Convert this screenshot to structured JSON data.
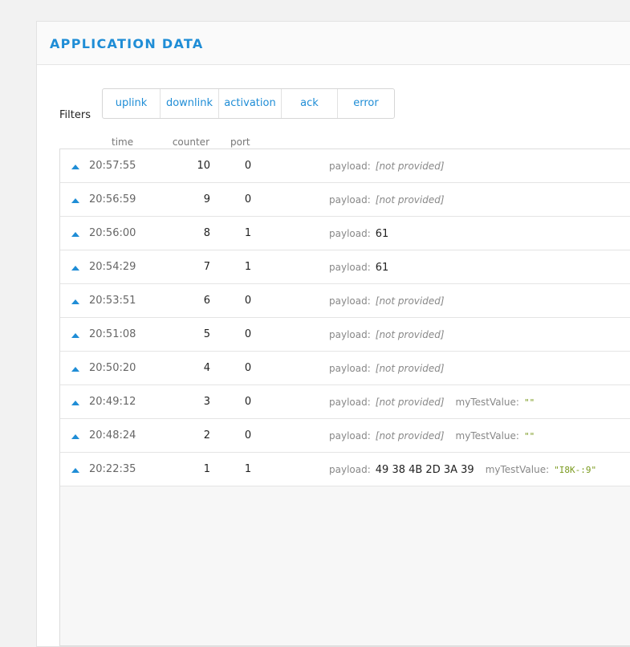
{
  "panel": {
    "title": "APPLICATION DATA"
  },
  "filters": {
    "label": "Filters",
    "buttons": [
      "uplink",
      "downlink",
      "activation",
      "ack",
      "error"
    ]
  },
  "columns": {
    "time": "time",
    "counter": "counter",
    "port": "port"
  },
  "colors": {
    "accent": "#1f8dd6",
    "string_value": "#7a9a1e"
  },
  "icons": {
    "row_direction": "uplink-arrow-icon"
  },
  "rows": [
    {
      "time": "20:57:55",
      "counter": "10",
      "port": "0",
      "payload_label": "payload:",
      "payload": "[not provided]",
      "payload_missing": true
    },
    {
      "time": "20:56:59",
      "counter": "9",
      "port": "0",
      "payload_label": "payload:",
      "payload": "[not provided]",
      "payload_missing": true
    },
    {
      "time": "20:56:00",
      "counter": "8",
      "port": "1",
      "payload_label": "payload:",
      "payload": "61",
      "payload_missing": false
    },
    {
      "time": "20:54:29",
      "counter": "7",
      "port": "1",
      "payload_label": "payload:",
      "payload": "61",
      "payload_missing": false
    },
    {
      "time": "20:53:51",
      "counter": "6",
      "port": "0",
      "payload_label": "payload:",
      "payload": "[not provided]",
      "payload_missing": true
    },
    {
      "time": "20:51:08",
      "counter": "5",
      "port": "0",
      "payload_label": "payload:",
      "payload": "[not provided]",
      "payload_missing": true
    },
    {
      "time": "20:50:20",
      "counter": "4",
      "port": "0",
      "payload_label": "payload:",
      "payload": "[not provided]",
      "payload_missing": true
    },
    {
      "time": "20:49:12",
      "counter": "3",
      "port": "0",
      "payload_label": "payload:",
      "payload": "[not provided]",
      "payload_missing": true,
      "extra_label": "myTestValue:",
      "extra_value": "\"\""
    },
    {
      "time": "20:48:24",
      "counter": "2",
      "port": "0",
      "payload_label": "payload:",
      "payload": "[not provided]",
      "payload_missing": true,
      "extra_label": "myTestValue:",
      "extra_value": "\"\""
    },
    {
      "time": "20:22:35",
      "counter": "1",
      "port": "1",
      "payload_label": "payload:",
      "payload": "49 38 4B 2D 3A 39",
      "payload_missing": false,
      "extra_label": "myTestValue:",
      "extra_value": "\"I8K-:9\""
    }
  ]
}
